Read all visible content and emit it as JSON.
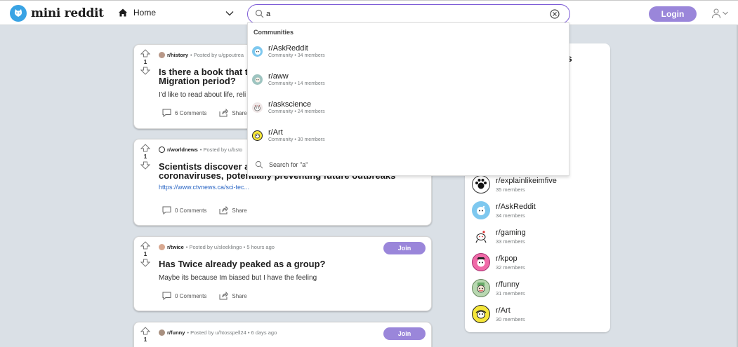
{
  "app": {
    "name": "mini reddit"
  },
  "nav": {
    "home_label": "Home",
    "login_label": "Login"
  },
  "search": {
    "value": "a"
  },
  "dropdown": {
    "heading": "Communities",
    "items": [
      {
        "name": "r/AskReddit",
        "sub": "Community • 34 members",
        "color": "#7ec8ef",
        "glyph": "☻"
      },
      {
        "name": "r/aww",
        "sub": "Community • 14 members",
        "color": "#9ec4c0",
        "glyph": "☺"
      },
      {
        "name": "r/askscience",
        "sub": "Community • 24 members",
        "color": "#f0e8e8",
        "glyph": "⚗"
      },
      {
        "name": "r/Art",
        "sub": "Community • 30 members",
        "color": "#f5e63a",
        "glyph": "☺"
      }
    ],
    "search_for": "Search for \"a\""
  },
  "posts": [
    {
      "votes": "1",
      "subreddit": "r/history",
      "posted_by": "• Posted by u/gpoutrea",
      "title": "Is there a book that tou\nMigration period?",
      "body": "I'd like to read about life, reli",
      "link": "",
      "comments": "6 Comments",
      "share": "Share",
      "join": ""
    },
    {
      "votes": "1",
      "subreddit": "r/worldnews",
      "posted_by": "• Posted by u/bsto",
      "title": "Scientists discover anti\ncoronaviruses, potentially preventing future outbreaks",
      "body": "",
      "link": "https://www.ctvnews.ca/sci-tec...",
      "comments": "0 Comments",
      "share": "Share",
      "join": ""
    },
    {
      "votes": "1",
      "subreddit": "r/twice",
      "posted_by": "• Posted by u/sleeklingo • 5 hours ago",
      "title": "Has Twice already peaked as a group?",
      "body": "Maybe its because Im biased but I have the feeling",
      "link": "",
      "comments": "0 Comments",
      "share": "Share",
      "join": "Join"
    },
    {
      "votes": "1",
      "subreddit": "r/funny",
      "posted_by": "• Posted by u/htosspell24 • 6 days ago",
      "title": "",
      "body": "",
      "link": "",
      "comments": "",
      "share": "",
      "join": "Join"
    }
  ],
  "sidebar": {
    "heading_fragment": "s",
    "communities": [
      {
        "name": "r/explainlikeimfive",
        "members": "35 members",
        "color": "#ffffff",
        "glyph": "🐾"
      },
      {
        "name": "r/AskReddit",
        "members": "34 members",
        "color": "#7ec8ef",
        "glyph": "☻"
      },
      {
        "name": "r/gaming",
        "members": "33 members",
        "color": "#ffffff",
        "glyph": "♞"
      },
      {
        "name": "r/kpop",
        "members": "32 members",
        "color": "#f06aa8",
        "glyph": "★"
      },
      {
        "name": "r/funny",
        "members": "31 members",
        "color": "#b8d8b0",
        "glyph": "☺"
      },
      {
        "name": "r/Art",
        "members": "30 members",
        "color": "#f5e63a",
        "glyph": "☺"
      }
    ]
  }
}
